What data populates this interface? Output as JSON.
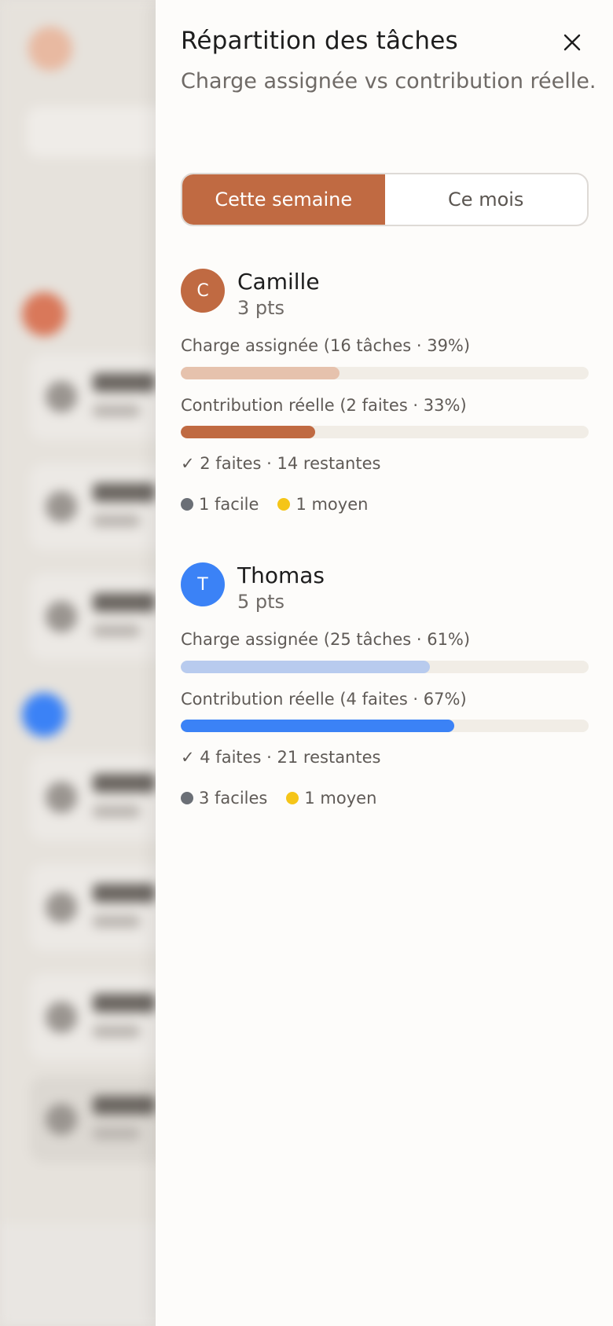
{
  "colors": {
    "accent": "#c06a42",
    "camille_avatar": "#c06a42",
    "camille_assigned": "#e6c2ad",
    "camille_actual": "#c06a42",
    "thomas_avatar": "#3b82f6",
    "thomas_assigned": "#b8cbee",
    "thomas_actual": "#3b82f6",
    "easy_dot": "#6b6f76",
    "medium_dot": "#f5c518"
  },
  "panel": {
    "title": "Répartition des tâches",
    "subtitle": "Charge assignée vs contribution réelle.",
    "close_icon": "close-icon"
  },
  "period_toggle": {
    "options": [
      "Cette semaine",
      "Ce mois"
    ],
    "selected": "Cette semaine"
  },
  "people": [
    {
      "initial": "C",
      "name": "Camille",
      "points": "3 pts",
      "assigned_label": "Charge assignée (16 tâches · 39%)",
      "assigned_pct": 0.39,
      "actual_label": "Contribution réelle (2 faites · 33%)",
      "actual_pct": 0.33,
      "done_summary": "✓ 2 faites · 14 restantes",
      "legend": [
        {
          "label": "1 facile",
          "dot": "easy"
        },
        {
          "label": "1 moyen",
          "dot": "medium"
        }
      ]
    },
    {
      "initial": "T",
      "name": "Thomas",
      "points": "5 pts",
      "assigned_label": "Charge assignée (25 tâches · 61%)",
      "assigned_pct": 0.61,
      "actual_label": "Contribution réelle (4 faites · 67%)",
      "actual_pct": 0.67,
      "done_summary": "✓ 4 faites · 21 restantes",
      "legend": [
        {
          "label": "3 faciles",
          "dot": "easy"
        },
        {
          "label": "1 moyen",
          "dot": "medium"
        }
      ]
    }
  ]
}
